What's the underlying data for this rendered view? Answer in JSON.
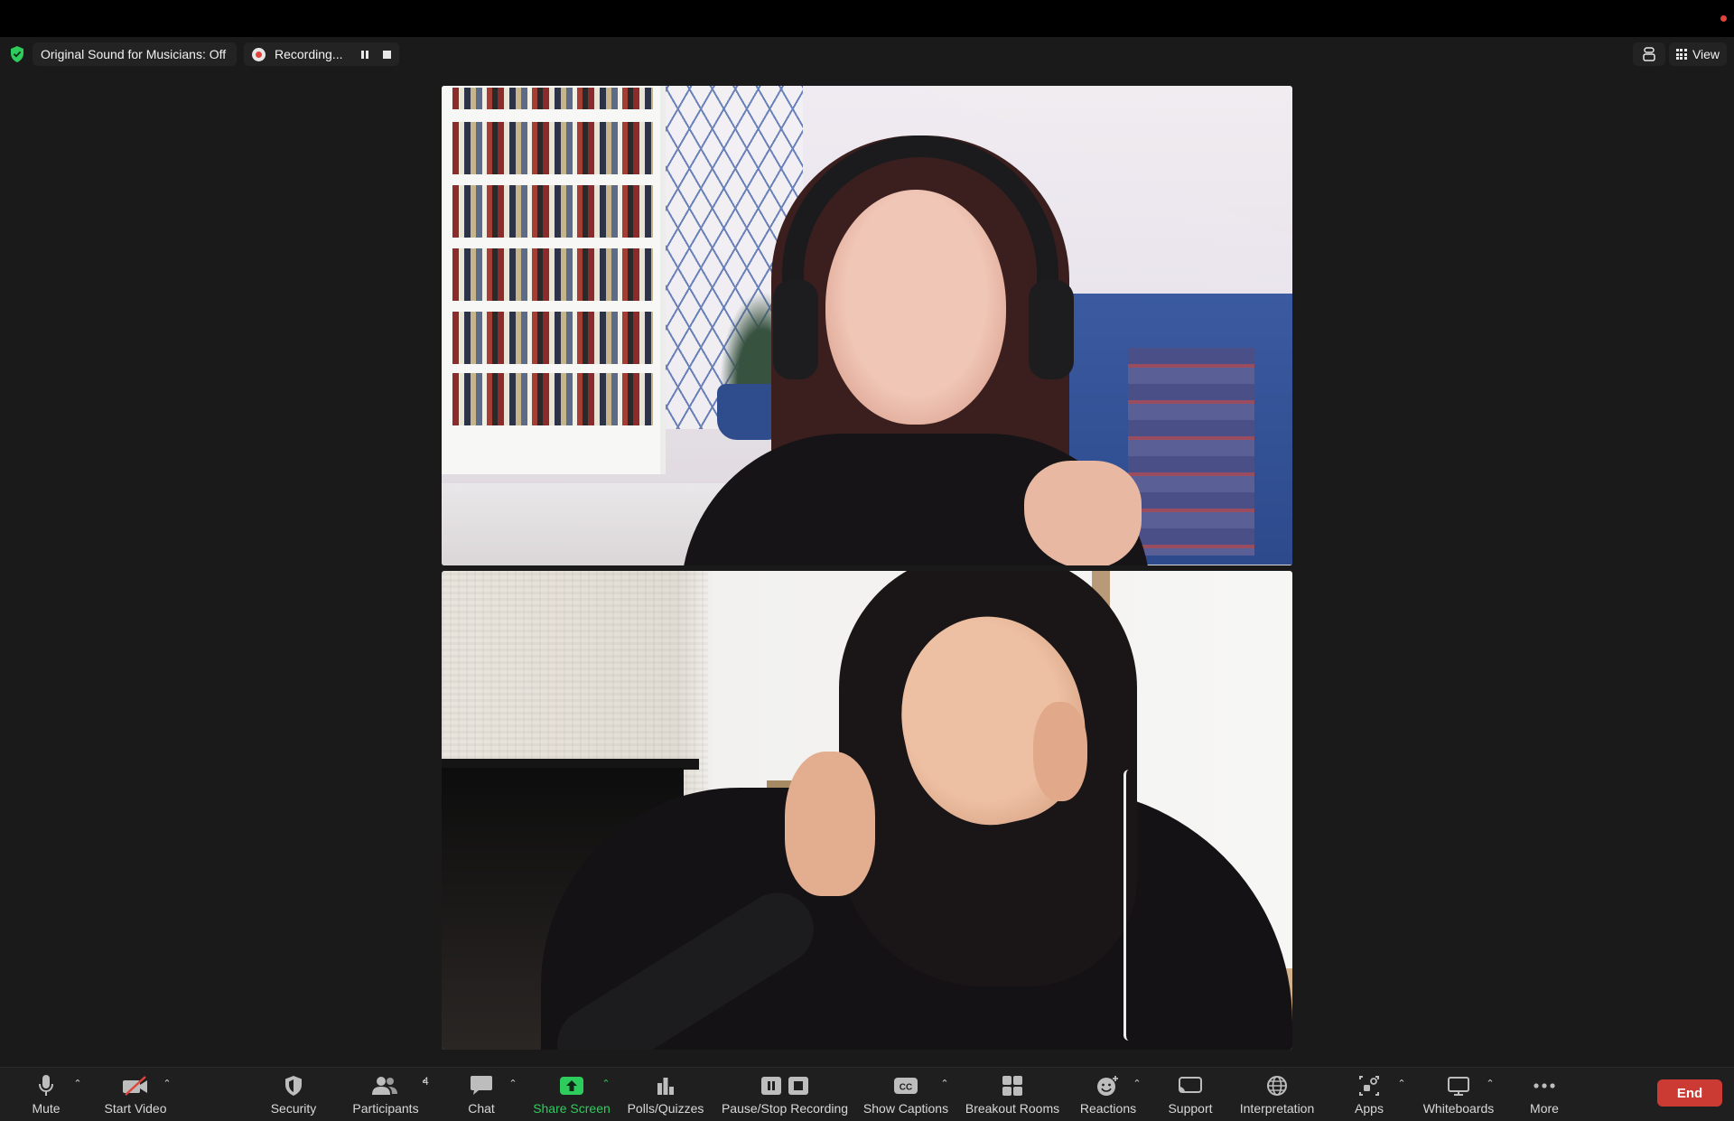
{
  "top_bar": {
    "original_sound": "Original Sound for Musicians: Off",
    "recording": "Recording...",
    "view": "View"
  },
  "toolbar": {
    "items": [
      {
        "label": "Mute",
        "icon": "microphone-icon"
      },
      {
        "label": "Start Video",
        "icon": "video-off-icon"
      },
      {
        "label": "Security",
        "icon": "shield-icon"
      },
      {
        "label": "Participants",
        "icon": "participants-icon",
        "count": "4"
      },
      {
        "label": "Chat",
        "icon": "chat-icon"
      },
      {
        "label": "Share Screen",
        "icon": "share-screen-icon"
      },
      {
        "label": "Polls/Quizzes",
        "icon": "poll-icon"
      },
      {
        "label": "Pause/Stop Recording",
        "icon": "pause-stop-icon"
      },
      {
        "label": "Show Captions",
        "icon": "cc-icon"
      },
      {
        "label": "Breakout Rooms",
        "icon": "breakout-icon"
      },
      {
        "label": "Reactions",
        "icon": "reactions-icon"
      },
      {
        "label": "Support",
        "icon": "support-icon"
      },
      {
        "label": "Interpretation",
        "icon": "globe-icon"
      },
      {
        "label": "Apps",
        "icon": "apps-icon"
      },
      {
        "label": "Whiteboards",
        "icon": "whiteboard-icon"
      },
      {
        "label": "More",
        "icon": "more-icon"
      }
    ],
    "end": "End"
  },
  "colors": {
    "accent_green": "#2ecc5c",
    "recording_red": "#e0433a",
    "end_red": "#cc3b33",
    "background": "#1a1a1a"
  }
}
